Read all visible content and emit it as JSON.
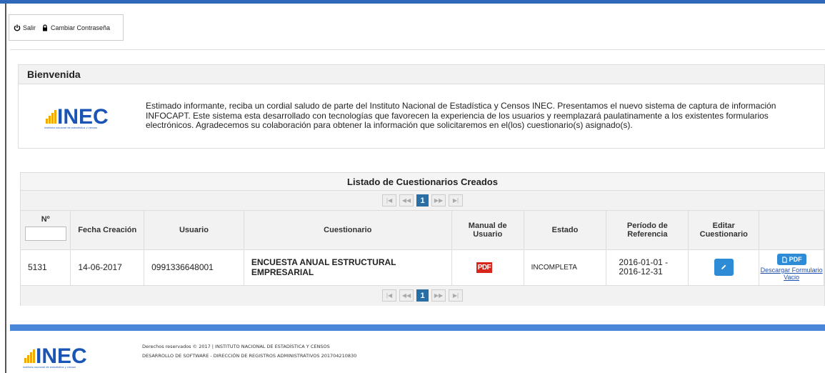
{
  "toolbar": {
    "logout_label": "Salir",
    "change_password_label": "Cambiar Contraseña"
  },
  "welcome": {
    "title": "Bienvenida",
    "logo_text": "INEC",
    "logo_subtitle": "instituto nacional de estadística y censos",
    "message": "Estimado informante, reciba un cordial saludo de parte del Instituto Nacional de Estadística y Censos INEC. Presentamos el nuevo sistema de captura de información INFOCAPT. Este sistema esta desarrollado con tecnologías que favorecen la experiencia de los usuarios y reemplazará paulatinamente a los existentes formularios electrónicos. Agradecemos su colaboración para obtener la información que solicitaremos en el(los) cuestionario(s) asignado(s)."
  },
  "listing": {
    "title": "Listado de Cuestionarios Creados",
    "pager": {
      "first": "|◀",
      "prev": "◀◀",
      "page": "1",
      "next": "▶▶",
      "last": "▶|"
    },
    "columns": {
      "num": "Nº",
      "created": "Fecha Creación",
      "user": "Usuario",
      "questionnaire": "Cuestionario",
      "manual": "Manual de Usuario",
      "status": "Estado",
      "period": "Período de Referencia",
      "edit": "Editar Cuestionario"
    },
    "rows": [
      {
        "num": "5131",
        "created": "14-06-2017",
        "user": "0991336648001",
        "questionnaire": "ENCUESTA ANUAL ESTRUCTURAL EMPRESARIAL",
        "manual_icon": "PDF",
        "status": "INCOMPLETA",
        "period_start": "2016-01-01 -",
        "period_end": "2016-12-31",
        "pdf_label": "PDF",
        "download_label": "Descargar Formulario Vacio"
      }
    ]
  },
  "footer": {
    "rights": "Derechos reservados © 2017 | INSTITUTO NACIONAL DE ESTADÍSTICA Y CENSOS",
    "dev": "DESARROLLO DE SOFTWARE - DIRECCIÓN DE REGISTROS ADMINISTRATIVOS 201704210830"
  },
  "colors": {
    "primary": "#2e8bd6",
    "brand_blue": "#1a55b5",
    "pdf_red": "#d9261c",
    "footer_bar": "#4a86d8"
  }
}
